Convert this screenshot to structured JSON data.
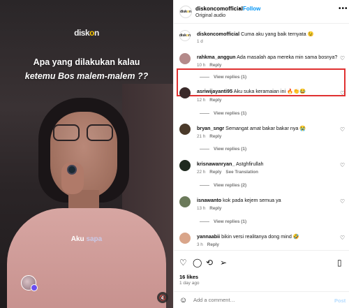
{
  "media": {
    "brand": {
      "part1": "disk",
      "part2": "o",
      "part3": "n"
    },
    "caption_line1": "Apa yang dilakukan kalau",
    "caption_line2": "ketemu Bos malem-malem ??",
    "caption_mid_1": "Aku",
    "caption_mid_2": "sapa",
    "mute_icon": "speaker-muted-icon"
  },
  "header": {
    "username": "diskoncomofficial",
    "dot": "•",
    "follow_label": "Follow",
    "audio": "Original audio",
    "more": "•••"
  },
  "caption_comment": {
    "username": "diskoncomofficial",
    "text": "Cuma aku yang baik ternyata 😉",
    "time": "1 d"
  },
  "comments": [
    {
      "username": "rahkma_anggun",
      "text": "Ada masalah apa mereka min sama bosnya?",
      "time": "10 h",
      "reply": "Reply",
      "view_replies": "View replies (1)",
      "avatar_color": "#b48a8a"
    },
    {
      "username": "asriwijayanti95",
      "text": "Aku suka keramaian ini 🔥👏😂",
      "time": "12 h",
      "reply": "Reply",
      "view_replies": "View replies (1)",
      "avatar_color": "#3a2a2a"
    },
    {
      "username": "bryan_sngr",
      "text": "Semangat amat bakar bakar nya 😭",
      "time": "21 h",
      "reply": "Reply",
      "view_replies": "View replies (1)",
      "avatar_color": "#4a3a2a"
    },
    {
      "username": "krisnawanryan_",
      "text": "Astghfirullah",
      "time": "22 h",
      "reply": "Reply",
      "translation": "See Translation",
      "view_replies": "View replies (2)",
      "avatar_color": "#1f2a1f"
    },
    {
      "username": "isnawanto",
      "text": "kok pada kejem semua ya",
      "time": "13 h",
      "reply": "Reply",
      "view_replies": "View replies (1)",
      "avatar_color": "#6b7a5a"
    },
    {
      "username": "yannaabii",
      "text": "bikin versi realitanya dong mind 🤣",
      "time": "3 h",
      "reply": "Reply",
      "avatar_color": "#d9a58a"
    }
  ],
  "actions": {
    "likes": "16 likes",
    "ago": "1 day ago",
    "add_placeholder": "Add a comment…",
    "post_label": "Post"
  }
}
